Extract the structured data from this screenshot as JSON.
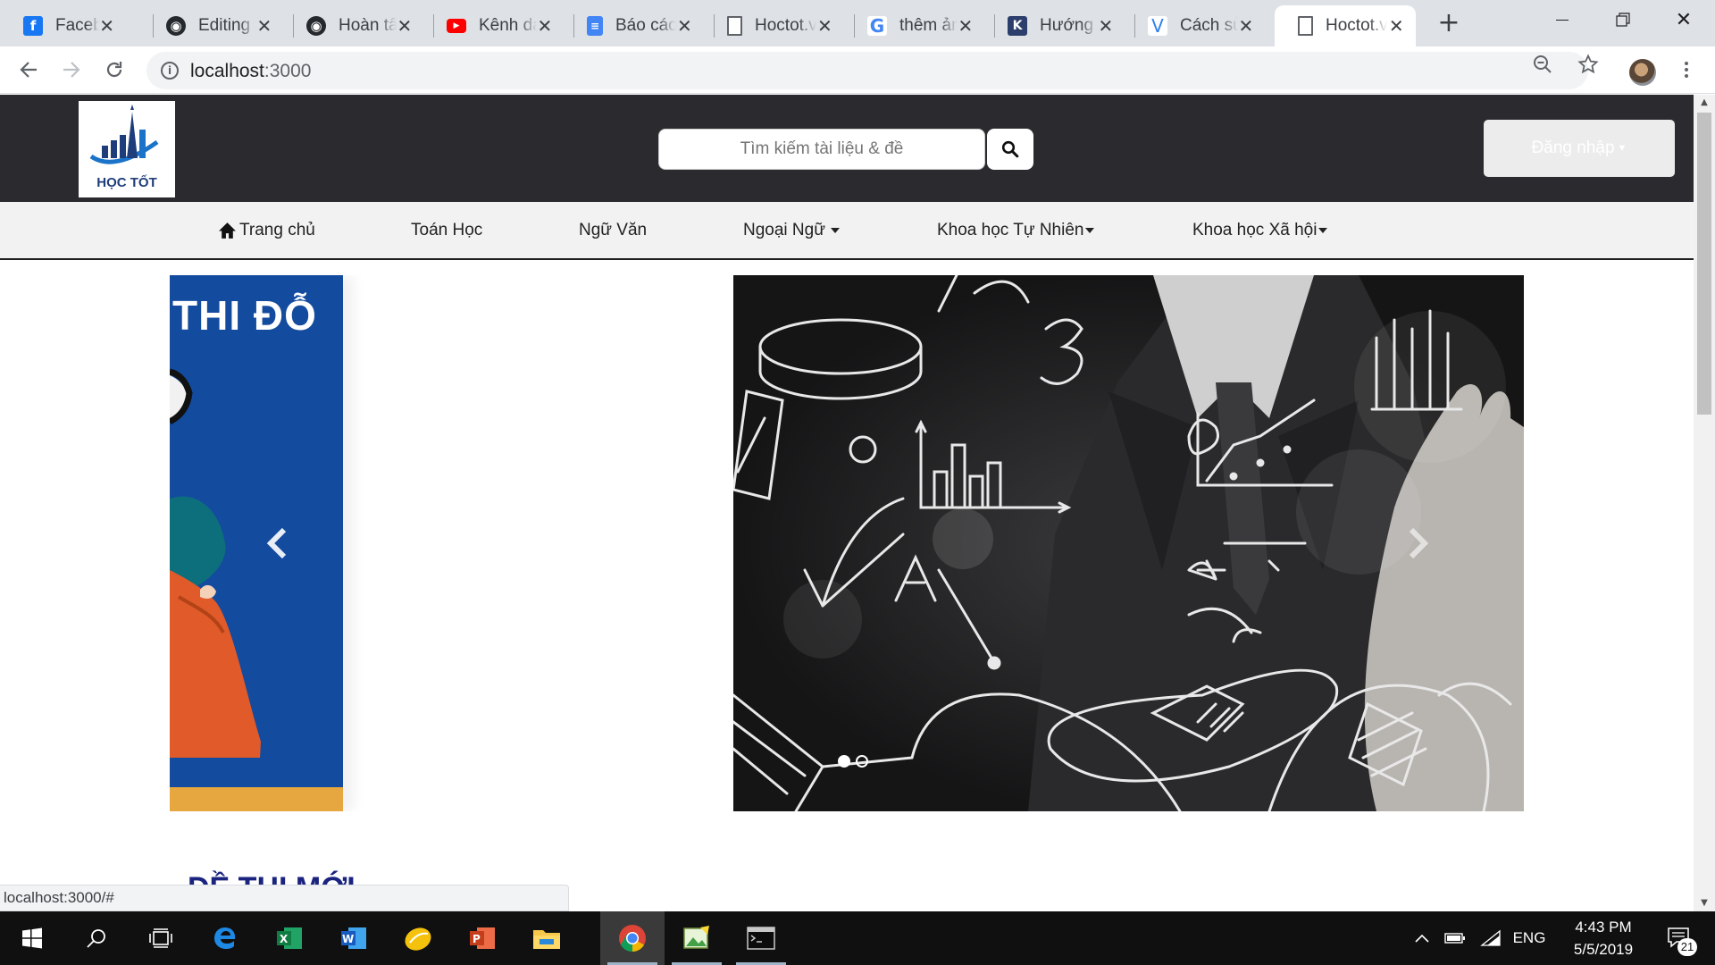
{
  "browser": {
    "tabs": [
      {
        "title": "Facebook",
        "icon": "facebook-icon",
        "color": "#1877f2"
      },
      {
        "title": "Editing",
        "icon": "github-icon",
        "color": "#24292e"
      },
      {
        "title": "Hoàn tất",
        "icon": "github-icon",
        "color": "#24292e"
      },
      {
        "title": "Kênh dạy",
        "icon": "youtube-icon",
        "color": "#ff0000"
      },
      {
        "title": "Báo cáo",
        "icon": "google-docs-icon",
        "color": "#4285f4"
      },
      {
        "title": "Hoctot.vn",
        "icon": "page-icon",
        "color": "#5f6368"
      },
      {
        "title": "thêm ảnh",
        "icon": "google-icon",
        "color": "#4285f4"
      },
      {
        "title": "Hướng dẫn",
        "icon": "k-site-icon",
        "color": "#2c3e6b"
      },
      {
        "title": "Cách sử",
        "icon": "v-site-icon",
        "color": "#2f80ed"
      },
      {
        "title": "Hoctot.vn",
        "icon": "page-icon",
        "color": "#5f6368",
        "active": true
      }
    ],
    "url_host": "localhost",
    "url_port": ":3000"
  },
  "site": {
    "logo_text": "HỌC TỐT",
    "search_placeholder": "Tìm kiếm tài liệu & đề",
    "login_label": "Đăng nhập",
    "nav": [
      {
        "label": "Trang chủ",
        "icon": "home-icon"
      },
      {
        "label": "Toán Học"
      },
      {
        "label": "Ngữ Văn"
      },
      {
        "label": "Ngoại Ngữ",
        "dropdown": true
      },
      {
        "label": "Khoa học Tự Nhiên",
        "dropdown": true
      },
      {
        "label": "Khoa học Xã hội",
        "dropdown": true
      }
    ],
    "carousel": {
      "slide_text": "THI ĐỖ",
      "slide_count": 2,
      "active_slide": 1
    },
    "section_title": "ĐỀ THI MỚI"
  },
  "status_url": "localhost:3000/#",
  "taskbar": {
    "apps": [
      "windows-start-icon",
      "search-icon",
      "task-view-icon",
      "edge-icon",
      "excel-icon",
      "word-icon",
      "lemon-app-icon",
      "powerpoint-icon",
      "file-explorer-icon",
      "chrome-icon",
      "paint-icon",
      "terminal-icon"
    ],
    "language": "ENG",
    "time": "4:43 PM",
    "date": "5/5/2019",
    "notifications": "21"
  },
  "colors": {
    "header_bg": "#2b2a2f",
    "nav_bg": "#f3f2f2",
    "accent_blue": "#134b9e",
    "taskbar_bg": "#101010"
  }
}
